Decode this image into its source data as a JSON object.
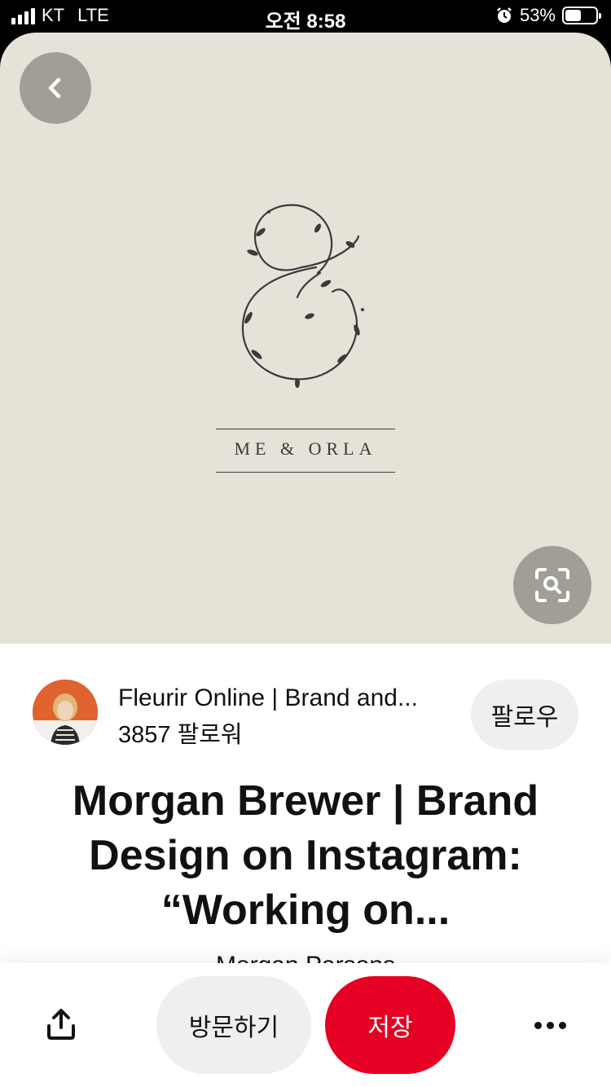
{
  "status_bar": {
    "carrier": "KT",
    "network": "LTE",
    "time": "오전 8:58",
    "battery_percent": "53%",
    "battery_level": 0.53,
    "icons": [
      "signal-icon",
      "alarm-icon",
      "battery-icon"
    ]
  },
  "hero": {
    "background_color": "#e5e2d8",
    "brand_text": "ME & ORLA",
    "icons": [
      "back-chevron-icon",
      "visual-search-icon"
    ]
  },
  "creator": {
    "name": "Fleurir Online | Brand and...",
    "followers": "3857 팔로워",
    "follow_label": "팔로우"
  },
  "pin": {
    "title": "Morgan Brewer | Brand Design on Instagram: “Working on...",
    "author": "Morgan Parsons"
  },
  "actions": {
    "visit_label": "방문하기",
    "save_label": "저장",
    "save_color": "#e60023",
    "icons": [
      "share-icon",
      "more-icon"
    ]
  }
}
